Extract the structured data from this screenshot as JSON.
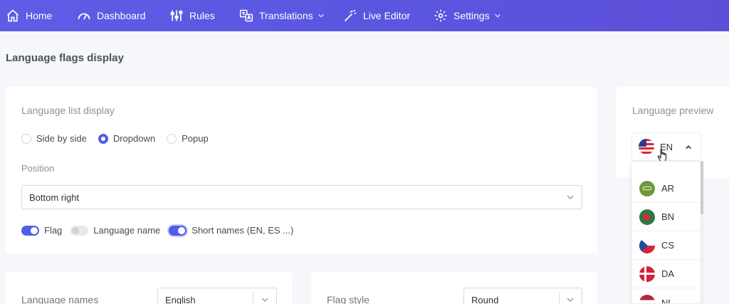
{
  "nav": {
    "items": [
      {
        "label": "Home",
        "icon": "home-icon"
      },
      {
        "label": "Dashboard",
        "icon": "gauge-icon"
      },
      {
        "label": "Rules",
        "icon": "sliders-icon"
      },
      {
        "label": "Translations",
        "icon": "translate-icon",
        "dropdown": true
      },
      {
        "label": "Live Editor",
        "icon": "magic-wand-icon"
      },
      {
        "label": "Settings",
        "icon": "gear-icon",
        "dropdown": true
      }
    ]
  },
  "page": {
    "title": "Language flags display"
  },
  "list_display": {
    "title": "Language list display",
    "options": [
      {
        "label": "Side by side",
        "selected": false
      },
      {
        "label": "Dropdown",
        "selected": true
      },
      {
        "label": "Popup",
        "selected": false
      }
    ],
    "position_label": "Position",
    "position_value": "Bottom right",
    "toggles": [
      {
        "label": "Flag",
        "on": true
      },
      {
        "label": "Language name",
        "on": false
      },
      {
        "label": "Short names (EN, ES ...)",
        "on": true
      }
    ]
  },
  "language_names": {
    "label": "Language names",
    "value": "English"
  },
  "flag_style": {
    "label": "Flag style",
    "value": "Round"
  },
  "preview": {
    "title": "Language preview",
    "current": {
      "code": "EN",
      "flag": "us-flag-icon"
    },
    "languages": [
      {
        "code": "AR",
        "flag": "sa-flag-icon"
      },
      {
        "code": "BN",
        "flag": "bd-flag-icon"
      },
      {
        "code": "CS",
        "flag": "cz-flag-icon"
      },
      {
        "code": "DA",
        "flag": "dk-flag-icon"
      },
      {
        "code": "NL",
        "flag": "nl-flag-icon"
      }
    ]
  },
  "colors": {
    "accent": "#4f5de8",
    "nav_bg": "#5b56e0"
  }
}
